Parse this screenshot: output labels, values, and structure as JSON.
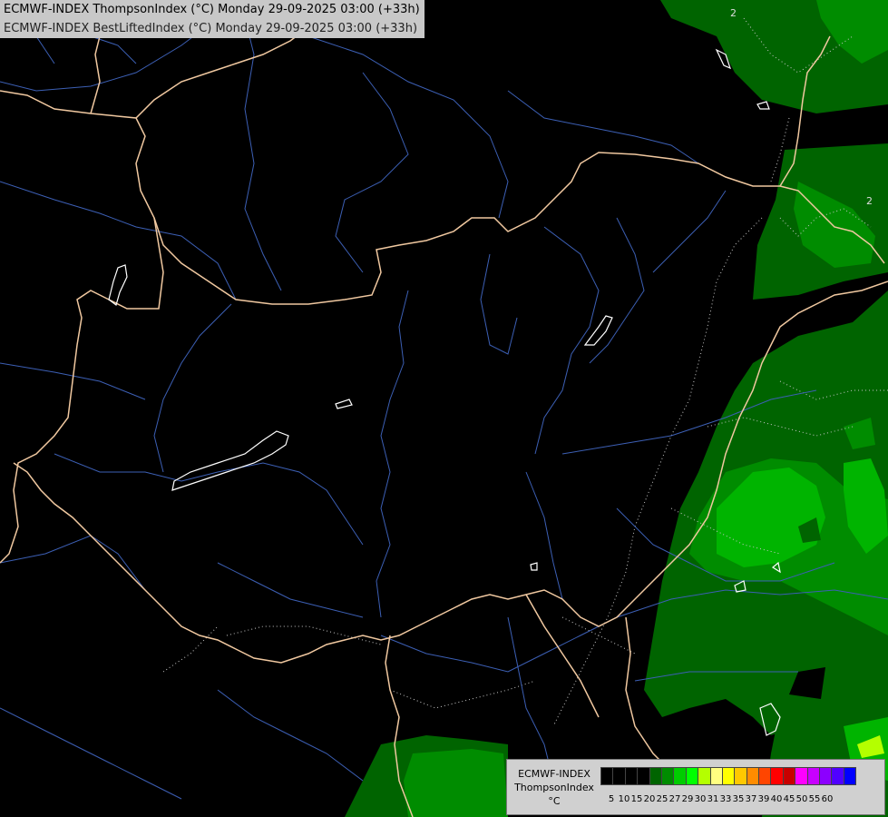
{
  "title": {
    "line1": "ECMWF-INDEX ThompsonIndex (°C) Monday 29-09-2025 03:00 (+33h)",
    "line2": "ECMWF-INDEX BestLiftedIndex (°C) Monday 29-09-2025 03:00 (+33h)"
  },
  "legend": {
    "model": "ECMWF-INDEX",
    "variable": "ThompsonIndex",
    "unit": "°C",
    "ticks": [
      "5",
      "10",
      "15",
      "20",
      "25",
      "27",
      "29",
      "30",
      "31",
      "33",
      "35",
      "37",
      "39",
      "40",
      "45",
      "50",
      "55",
      "60"
    ],
    "colors": [
      "#000000",
      "#000000",
      "#000000",
      "#000000",
      "#006400",
      "#008c00",
      "#00cc00",
      "#00ff00",
      "#b4ff00",
      "#ffff80",
      "#ffff00",
      "#ffc800",
      "#ff8c00",
      "#ff4500",
      "#ff0000",
      "#c80000",
      "#ff00ff",
      "#c800ff",
      "#8c00ff",
      "#5000ff",
      "#0000ff"
    ]
  },
  "map": {
    "contour_labels": [
      "2",
      "2"
    ],
    "colors": {
      "background": "#000000",
      "border": "#f0c8a0",
      "river": "#3c5fb4",
      "lake_outline": "#ffffff",
      "dotted_contour": "#c8c8c8",
      "ti_25": "#006400",
      "ti_27": "#008c00",
      "ti_29": "#00cc00"
    }
  }
}
